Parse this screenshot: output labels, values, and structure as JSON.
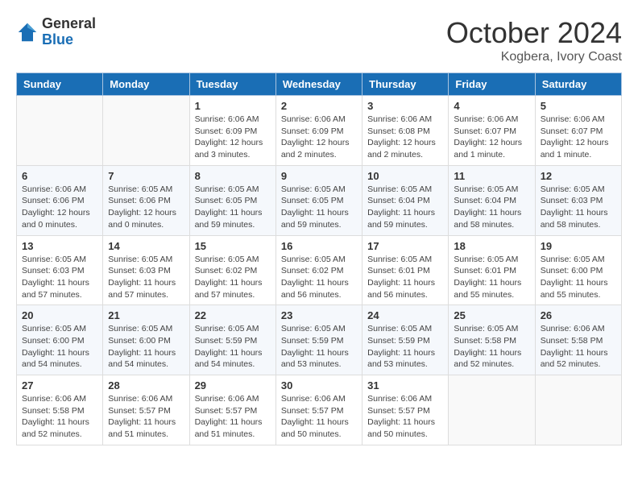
{
  "header": {
    "logo_general": "General",
    "logo_blue": "Blue",
    "month": "October 2024",
    "location": "Kogbera, Ivory Coast"
  },
  "columns": [
    "Sunday",
    "Monday",
    "Tuesday",
    "Wednesday",
    "Thursday",
    "Friday",
    "Saturday"
  ],
  "weeks": [
    [
      {
        "day": "",
        "info": ""
      },
      {
        "day": "",
        "info": ""
      },
      {
        "day": "1",
        "sunrise": "6:06 AM",
        "sunset": "6:09 PM",
        "daylight": "12 hours and 3 minutes."
      },
      {
        "day": "2",
        "sunrise": "6:06 AM",
        "sunset": "6:09 PM",
        "daylight": "12 hours and 2 minutes."
      },
      {
        "day": "3",
        "sunrise": "6:06 AM",
        "sunset": "6:08 PM",
        "daylight": "12 hours and 2 minutes."
      },
      {
        "day": "4",
        "sunrise": "6:06 AM",
        "sunset": "6:07 PM",
        "daylight": "12 hours and 1 minute."
      },
      {
        "day": "5",
        "sunrise": "6:06 AM",
        "sunset": "6:07 PM",
        "daylight": "12 hours and 1 minute."
      }
    ],
    [
      {
        "day": "6",
        "sunrise": "6:06 AM",
        "sunset": "6:06 PM",
        "daylight": "12 hours and 0 minutes."
      },
      {
        "day": "7",
        "sunrise": "6:05 AM",
        "sunset": "6:06 PM",
        "daylight": "12 hours and 0 minutes."
      },
      {
        "day": "8",
        "sunrise": "6:05 AM",
        "sunset": "6:05 PM",
        "daylight": "11 hours and 59 minutes."
      },
      {
        "day": "9",
        "sunrise": "6:05 AM",
        "sunset": "6:05 PM",
        "daylight": "11 hours and 59 minutes."
      },
      {
        "day": "10",
        "sunrise": "6:05 AM",
        "sunset": "6:04 PM",
        "daylight": "11 hours and 59 minutes."
      },
      {
        "day": "11",
        "sunrise": "6:05 AM",
        "sunset": "6:04 PM",
        "daylight": "11 hours and 58 minutes."
      },
      {
        "day": "12",
        "sunrise": "6:05 AM",
        "sunset": "6:03 PM",
        "daylight": "11 hours and 58 minutes."
      }
    ],
    [
      {
        "day": "13",
        "sunrise": "6:05 AM",
        "sunset": "6:03 PM",
        "daylight": "11 hours and 57 minutes."
      },
      {
        "day": "14",
        "sunrise": "6:05 AM",
        "sunset": "6:03 PM",
        "daylight": "11 hours and 57 minutes."
      },
      {
        "day": "15",
        "sunrise": "6:05 AM",
        "sunset": "6:02 PM",
        "daylight": "11 hours and 57 minutes."
      },
      {
        "day": "16",
        "sunrise": "6:05 AM",
        "sunset": "6:02 PM",
        "daylight": "11 hours and 56 minutes."
      },
      {
        "day": "17",
        "sunrise": "6:05 AM",
        "sunset": "6:01 PM",
        "daylight": "11 hours and 56 minutes."
      },
      {
        "day": "18",
        "sunrise": "6:05 AM",
        "sunset": "6:01 PM",
        "daylight": "11 hours and 55 minutes."
      },
      {
        "day": "19",
        "sunrise": "6:05 AM",
        "sunset": "6:00 PM",
        "daylight": "11 hours and 55 minutes."
      }
    ],
    [
      {
        "day": "20",
        "sunrise": "6:05 AM",
        "sunset": "6:00 PM",
        "daylight": "11 hours and 54 minutes."
      },
      {
        "day": "21",
        "sunrise": "6:05 AM",
        "sunset": "6:00 PM",
        "daylight": "11 hours and 54 minutes."
      },
      {
        "day": "22",
        "sunrise": "6:05 AM",
        "sunset": "5:59 PM",
        "daylight": "11 hours and 54 minutes."
      },
      {
        "day": "23",
        "sunrise": "6:05 AM",
        "sunset": "5:59 PM",
        "daylight": "11 hours and 53 minutes."
      },
      {
        "day": "24",
        "sunrise": "6:05 AM",
        "sunset": "5:59 PM",
        "daylight": "11 hours and 53 minutes."
      },
      {
        "day": "25",
        "sunrise": "6:05 AM",
        "sunset": "5:58 PM",
        "daylight": "11 hours and 52 minutes."
      },
      {
        "day": "26",
        "sunrise": "6:06 AM",
        "sunset": "5:58 PM",
        "daylight": "11 hours and 52 minutes."
      }
    ],
    [
      {
        "day": "27",
        "sunrise": "6:06 AM",
        "sunset": "5:58 PM",
        "daylight": "11 hours and 52 minutes."
      },
      {
        "day": "28",
        "sunrise": "6:06 AM",
        "sunset": "5:57 PM",
        "daylight": "11 hours and 51 minutes."
      },
      {
        "day": "29",
        "sunrise": "6:06 AM",
        "sunset": "5:57 PM",
        "daylight": "11 hours and 51 minutes."
      },
      {
        "day": "30",
        "sunrise": "6:06 AM",
        "sunset": "5:57 PM",
        "daylight": "11 hours and 50 minutes."
      },
      {
        "day": "31",
        "sunrise": "6:06 AM",
        "sunset": "5:57 PM",
        "daylight": "11 hours and 50 minutes."
      },
      {
        "day": "",
        "info": ""
      },
      {
        "day": "",
        "info": ""
      }
    ]
  ],
  "labels": {
    "sunrise": "Sunrise:",
    "sunset": "Sunset:",
    "daylight": "Daylight:"
  }
}
